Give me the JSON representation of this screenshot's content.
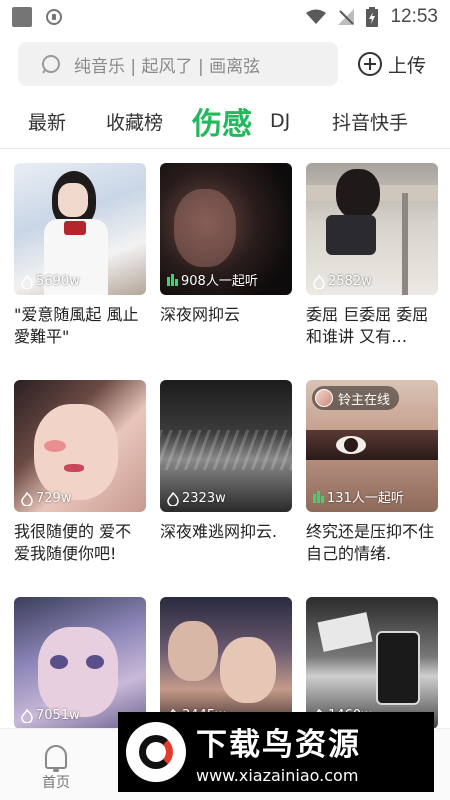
{
  "status_bar": {
    "time": "12:53"
  },
  "search": {
    "placeholder": "纯音乐 | 起风了 | 画离弦"
  },
  "header": {
    "upload_label": "上传"
  },
  "tabs": [
    {
      "label": "最新",
      "active": false
    },
    {
      "label": "收藏榜",
      "active": false
    },
    {
      "label": "伤感",
      "active": true
    },
    {
      "label": "DJ",
      "active": false
    },
    {
      "label": "抖音快手",
      "active": false
    }
  ],
  "cards": [
    {
      "title": "\"爱意随風起 風止愛難平\"",
      "stat": "5690w",
      "stat_icon": "flame-icon"
    },
    {
      "title": "深夜网抑云",
      "stat": "908人一起听",
      "stat_icon": "equalizer-icon"
    },
    {
      "title": "委屈 巨委屈 委屈和谁讲 又有…",
      "stat": "2582w",
      "stat_icon": "flame-icon"
    },
    {
      "title": "我很随便的 爱不爱我随便你吧!",
      "stat": "729w",
      "stat_icon": "flame-icon"
    },
    {
      "title": "深夜难逃网抑云.",
      "stat": "2323w",
      "stat_icon": "flame-icon"
    },
    {
      "title": "终究还是压抑不住自己的情绪.",
      "stat": "131人一起听",
      "stat_icon": "equalizer-icon",
      "badge": "铃主在线"
    },
    {
      "title": "",
      "stat": "7051w",
      "stat_icon": "flame-icon"
    },
    {
      "title": "",
      "stat": "3445w",
      "stat_icon": "flame-icon"
    },
    {
      "title": "",
      "stat": "1460w",
      "stat_icon": "flame-icon"
    }
  ],
  "bottom_nav": {
    "home_label": "首页"
  },
  "watermark": {
    "name": "下载鸟资源",
    "url": "www.xiazainiao.com"
  },
  "colors": {
    "accent": "#22b85c",
    "text": "#222222",
    "search_bg": "#f1f1f1"
  }
}
